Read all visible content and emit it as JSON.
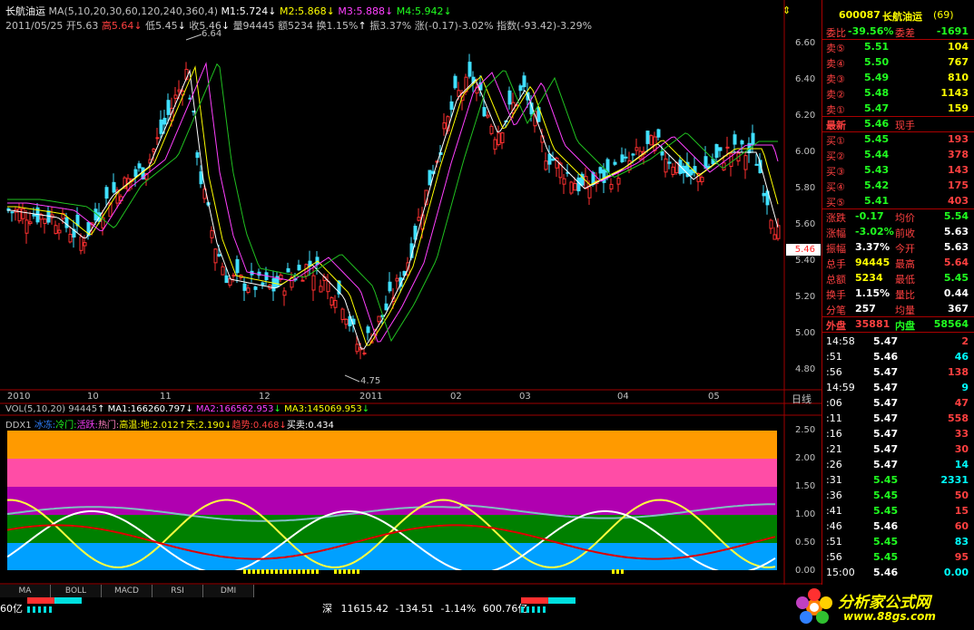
{
  "header": {
    "line1_name": "长航油运",
    "line1_ma": "MA(5,10,20,30,60,120,240,360,4)",
    "m1": "M1:5.724",
    "m2": "M2:5.868",
    "m3": "M3:5.888",
    "m4": "M4:5.942",
    "date": "2011/05/25",
    "open": "开5.63",
    "high": "高5.64",
    "low": "低5.45",
    "close": "收5.46",
    "vol": "量94445",
    "amount": "额5234",
    "turnover": "换1.15%",
    "amplitude": "振3.37%",
    "change": "涨(-0.17)-3.02%",
    "index": "指数(-93.42)-3.29%",
    "peak_label": "6.64",
    "trough_label": "4.75",
    "last_price_tag": "5.46"
  },
  "price_axis": [
    "6.60",
    "6.40",
    "6.20",
    "6.00",
    "5.80",
    "5.60",
    "5.40",
    "5.20",
    "5.00",
    "4.80"
  ],
  "time_axis": [
    "2010",
    "10",
    "11",
    "12",
    "2011",
    "02",
    "03",
    "04",
    "05"
  ],
  "period_label": "日线",
  "vol_header": {
    "vol": "VOL(5,10,20)",
    "vol_val": "94445",
    "ma1": "MA1:166260.797",
    "ma2": "MA2:166562.953",
    "ma3": "MA3:145069.953"
  },
  "ddx_header": {
    "name": "DDX1",
    "ice": "冰冻:",
    "cold": "冷门:",
    "active": "活跃:",
    "hot": "热门:",
    "high_temp": "高温:",
    "earth": "地:2.012",
    "sky": "天:2.190",
    "trend": "趋势:0.468",
    "buysell": "买卖:0.434"
  },
  "ddx_axis": [
    "2.50",
    "2.00",
    "1.50",
    "1.00",
    "0.50",
    "0.00"
  ],
  "tabs": [
    "MA",
    "BOLL",
    "MACD",
    "RSI",
    "DMI"
  ],
  "quote": {
    "code": "600087",
    "name": "长航油运",
    "num": "(69)",
    "weibi_label": "委比",
    "weibi": "-39.56%",
    "weicha_label": "委差",
    "weicha": "-1691",
    "asks": [
      {
        "label": "卖⑤",
        "price": "5.51",
        "vol": "104"
      },
      {
        "label": "卖④",
        "price": "5.50",
        "vol": "767"
      },
      {
        "label": "卖③",
        "price": "5.49",
        "vol": "810"
      },
      {
        "label": "卖②",
        "price": "5.48",
        "vol": "1143"
      },
      {
        "label": "卖①",
        "price": "5.47",
        "vol": "159"
      }
    ],
    "latest_label": "最新",
    "latest": "5.46",
    "xianshou_label": "现手",
    "bids": [
      {
        "label": "买①",
        "price": "5.45",
        "vol": "193"
      },
      {
        "label": "买②",
        "price": "5.44",
        "vol": "378"
      },
      {
        "label": "买③",
        "price": "5.43",
        "vol": "143"
      },
      {
        "label": "买④",
        "price": "5.42",
        "vol": "175"
      },
      {
        "label": "买⑤",
        "price": "5.41",
        "vol": "403"
      }
    ],
    "stats": [
      {
        "l1": "涨跌",
        "v1": "-0.17",
        "l2": "均价",
        "v2": "5.54"
      },
      {
        "l1": "涨幅",
        "v1": "-3.02%",
        "l2": "前收",
        "v2": "5.63"
      },
      {
        "l1": "振幅",
        "v1": "3.37%",
        "l2": "今开",
        "v2": "5.63"
      },
      {
        "l1": "总手",
        "v1": "94445",
        "l2": "最高",
        "v2": "5.64"
      },
      {
        "l1": "总额",
        "v1": "5234",
        "l2": "最低",
        "v2": "5.45"
      },
      {
        "l1": "换手",
        "v1": "1.15%",
        "l2": "量比",
        "v2": "0.44"
      },
      {
        "l1": "分笔",
        "v1": "257",
        "l2": "均量",
        "v2": "367"
      }
    ],
    "outer_label": "外盘",
    "outer": "35881",
    "inner_label": "内盘",
    "inner": "58564",
    "ticks": [
      {
        "t": "14:58",
        "p": "5.47",
        "v": "2"
      },
      {
        "t": ":51",
        "p": "5.46",
        "v": "46"
      },
      {
        "t": ":56",
        "p": "5.47",
        "v": "138"
      },
      {
        "t": "14:59",
        "p": "5.47",
        "v": "9"
      },
      {
        "t": ":06",
        "p": "5.47",
        "v": "47"
      },
      {
        "t": ":11",
        "p": "5.47",
        "v": "558"
      },
      {
        "t": ":16",
        "p": "5.47",
        "v": "33"
      },
      {
        "t": ":21",
        "p": "5.47",
        "v": "30"
      },
      {
        "t": ":26",
        "p": "5.47",
        "v": "14"
      },
      {
        "t": ":31",
        "p": "5.45",
        "v": "2331"
      },
      {
        "t": ":36",
        "p": "5.45",
        "v": "50"
      },
      {
        "t": ":41",
        "p": "5.45",
        "v": "15"
      },
      {
        "t": ":46",
        "p": "5.46",
        "v": "60"
      },
      {
        "t": ":51",
        "p": "5.45",
        "v": "83"
      },
      {
        "t": ":56",
        "p": "5.45",
        "v": "95"
      },
      {
        "t": "15:00",
        "p": "5.46",
        "v": "0.00"
      }
    ]
  },
  "ticker": {
    "left": "60亿",
    "market": "深",
    "index": "11615.42",
    "chg": "-134.51",
    "pct": "-1.14%",
    "amt": "600.76亿"
  },
  "logo": {
    "text": "分析家公式网",
    "url": "www.88gs.com"
  }
}
